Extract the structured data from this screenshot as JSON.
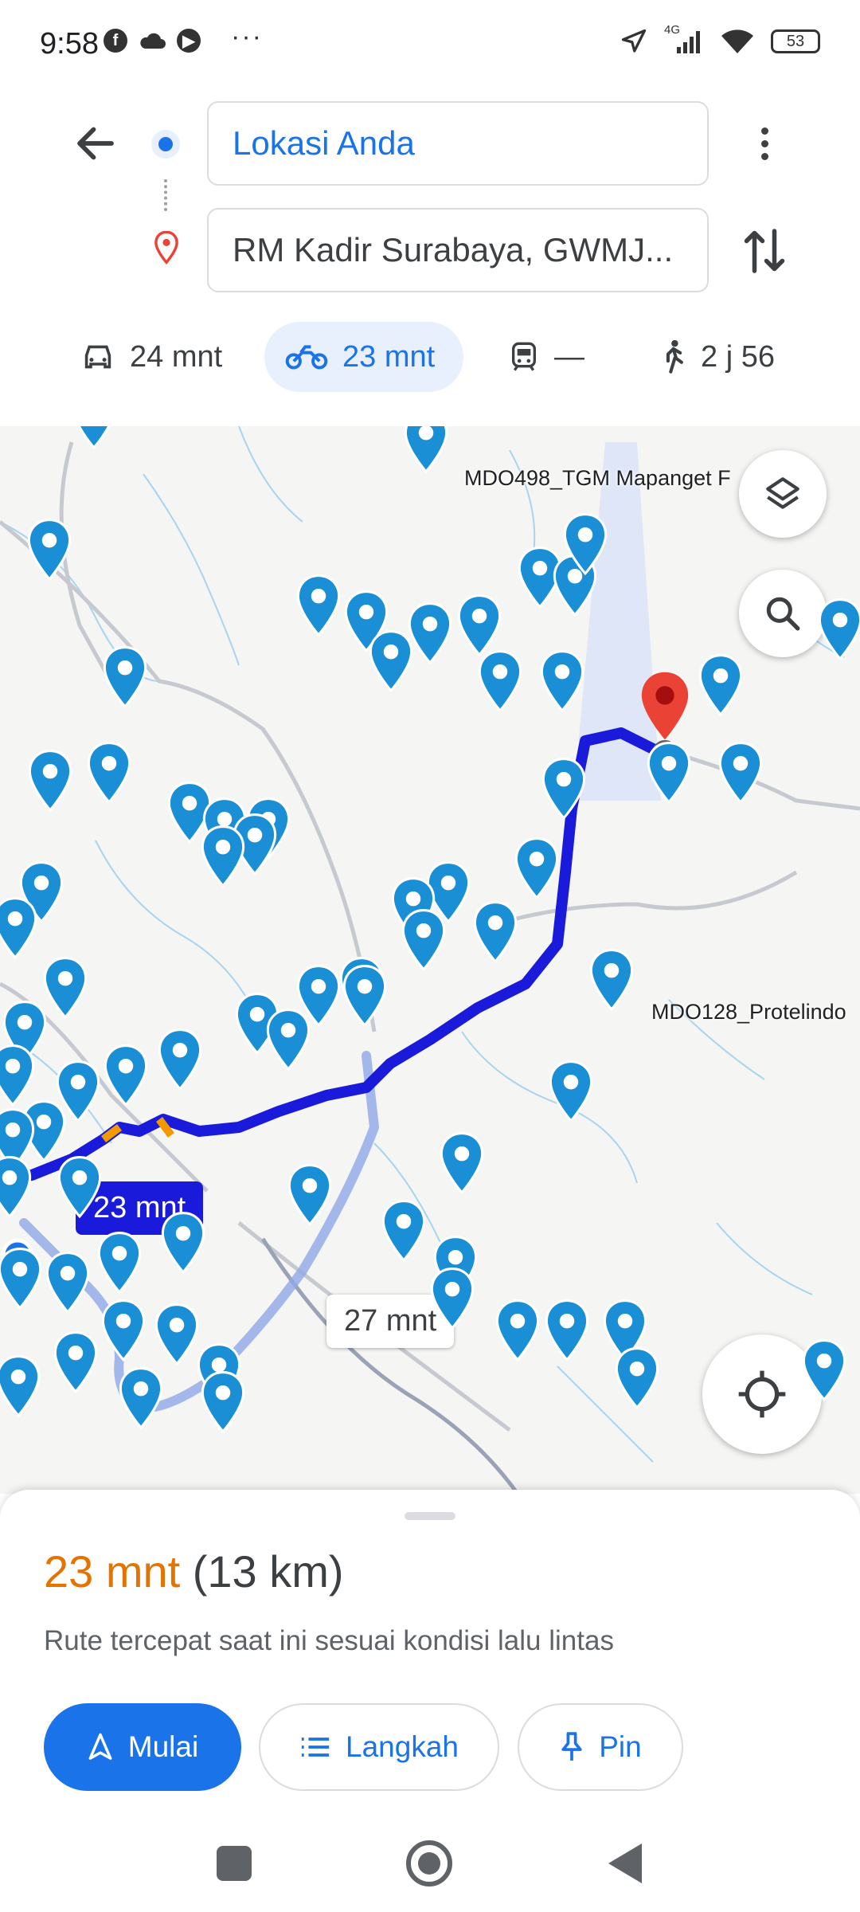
{
  "status_bar": {
    "time": "9:58",
    "network": "4G",
    "battery": "53"
  },
  "route": {
    "origin": "Lokasi Anda",
    "destination": "RM Kadir Surabaya, GWMJ..."
  },
  "modes": [
    {
      "icon": "car-icon",
      "label": "24 mnt"
    },
    {
      "icon": "motorcycle-icon",
      "label": "23 mnt"
    },
    {
      "icon": "train-icon",
      "label": "—"
    },
    {
      "icon": "walk-icon",
      "label": "2 j 56"
    }
  ],
  "map": {
    "labels": [
      "MDO498_TGM Mapanget F",
      "MDO128_Protelindo"
    ],
    "eta_primary": "23 mnt",
    "eta_alternative": "27 mnt"
  },
  "sheet": {
    "duration": "23 mnt",
    "distance": "(13 km)",
    "description": "Rute tercepat saat ini sesuai kondisi lalu lintas",
    "start_label": "Mulai",
    "steps_label": "Langkah",
    "pin_label": "Pin"
  },
  "colors": {
    "accent": "#1a73e8",
    "route": "#1a1adb",
    "duration": "#e37400",
    "destination": "#ea4335"
  }
}
